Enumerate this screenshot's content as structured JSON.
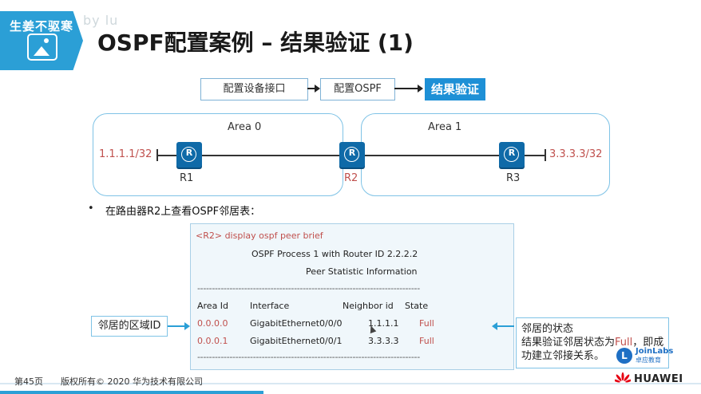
{
  "header": {
    "logo_text": "生姜不驱寒",
    "watermark": "by lu",
    "title": "OSPF配置案例 – 结果验证 (1)"
  },
  "steps": [
    "配置设备接口",
    "配置OSPF",
    "结果验证"
  ],
  "topology": {
    "area0_label": "Area 0",
    "area1_label": "Area 1",
    "router_symbol": "R",
    "routers": [
      "R1",
      "R2",
      "R3"
    ],
    "ip_left": "1.1.1.1/32",
    "ip_right": "3.3.3.3/32"
  },
  "bullet": {
    "symbol": "•",
    "text": "在路由器R2上查看OSPF邻居表："
  },
  "cli": {
    "prompt": "<R2> display ospf peer brief",
    "process": "OSPF Process 1 with Router ID 2.2.2.2",
    "stat": "Peer Statistic Information",
    "separator": "----------------------------------------------------------------------------",
    "headers": [
      "Area Id",
      "Interface",
      "Neighbor id",
      "State"
    ],
    "rows": [
      [
        "0.0.0.0",
        "GigabitEthernet0/0/0",
        "1.1.1.1",
        "Full"
      ],
      [
        "0.0.0.1",
        "GigabitEthernet0/0/1",
        "3.3.3.3",
        "Full"
      ]
    ]
  },
  "callouts": {
    "left": "邻居的区域ID",
    "right_line1": "邻居的状态",
    "right_line2_prefix": "结果验证邻居状态为",
    "right_line2_highlight": "Full",
    "right_line2_suffix": "，即成",
    "right_line3": "功建立邻接关系。"
  },
  "joinlabs": {
    "mark": "L",
    "name": "JoinLabs",
    "sub": "卓应教育"
  },
  "footer": {
    "page": "第45页",
    "copyright": "版权所有© 2020 华为技术有限公司",
    "brand": "HUAWEI"
  },
  "colors": {
    "accent": "#2b9fd6",
    "router": "#0f6aa8",
    "highlight_red": "#c0504d",
    "step_active": "#1e90d6"
  }
}
